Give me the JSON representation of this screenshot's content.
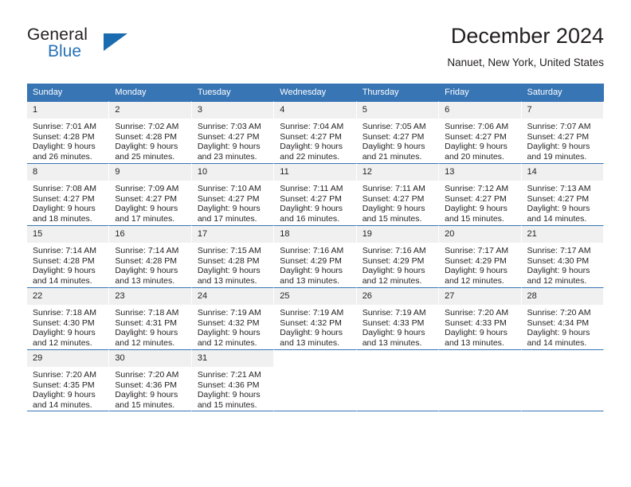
{
  "brand": {
    "name_top": "General",
    "name_bottom": "Blue",
    "accent_color": "#2572b8",
    "triangle_color": "#1a6bb0"
  },
  "header": {
    "title": "December 2024",
    "location": "Nanuet, New York, United States"
  },
  "calendar": {
    "header_bg": "#3875b5",
    "daynum_bg": "#f0f0f0",
    "weekdays": [
      "Sunday",
      "Monday",
      "Tuesday",
      "Wednesday",
      "Thursday",
      "Friday",
      "Saturday"
    ],
    "weeks": [
      [
        {
          "day": "1",
          "sunrise": "Sunrise: 7:01 AM",
          "sunset": "Sunset: 4:28 PM",
          "daylight1": "Daylight: 9 hours",
          "daylight2": "and 26 minutes."
        },
        {
          "day": "2",
          "sunrise": "Sunrise: 7:02 AM",
          "sunset": "Sunset: 4:28 PM",
          "daylight1": "Daylight: 9 hours",
          "daylight2": "and 25 minutes."
        },
        {
          "day": "3",
          "sunrise": "Sunrise: 7:03 AM",
          "sunset": "Sunset: 4:27 PM",
          "daylight1": "Daylight: 9 hours",
          "daylight2": "and 23 minutes."
        },
        {
          "day": "4",
          "sunrise": "Sunrise: 7:04 AM",
          "sunset": "Sunset: 4:27 PM",
          "daylight1": "Daylight: 9 hours",
          "daylight2": "and 22 minutes."
        },
        {
          "day": "5",
          "sunrise": "Sunrise: 7:05 AM",
          "sunset": "Sunset: 4:27 PM",
          "daylight1": "Daylight: 9 hours",
          "daylight2": "and 21 minutes."
        },
        {
          "day": "6",
          "sunrise": "Sunrise: 7:06 AM",
          "sunset": "Sunset: 4:27 PM",
          "daylight1": "Daylight: 9 hours",
          "daylight2": "and 20 minutes."
        },
        {
          "day": "7",
          "sunrise": "Sunrise: 7:07 AM",
          "sunset": "Sunset: 4:27 PM",
          "daylight1": "Daylight: 9 hours",
          "daylight2": "and 19 minutes."
        }
      ],
      [
        {
          "day": "8",
          "sunrise": "Sunrise: 7:08 AM",
          "sunset": "Sunset: 4:27 PM",
          "daylight1": "Daylight: 9 hours",
          "daylight2": "and 18 minutes."
        },
        {
          "day": "9",
          "sunrise": "Sunrise: 7:09 AM",
          "sunset": "Sunset: 4:27 PM",
          "daylight1": "Daylight: 9 hours",
          "daylight2": "and 17 minutes."
        },
        {
          "day": "10",
          "sunrise": "Sunrise: 7:10 AM",
          "sunset": "Sunset: 4:27 PM",
          "daylight1": "Daylight: 9 hours",
          "daylight2": "and 17 minutes."
        },
        {
          "day": "11",
          "sunrise": "Sunrise: 7:11 AM",
          "sunset": "Sunset: 4:27 PM",
          "daylight1": "Daylight: 9 hours",
          "daylight2": "and 16 minutes."
        },
        {
          "day": "12",
          "sunrise": "Sunrise: 7:11 AM",
          "sunset": "Sunset: 4:27 PM",
          "daylight1": "Daylight: 9 hours",
          "daylight2": "and 15 minutes."
        },
        {
          "day": "13",
          "sunrise": "Sunrise: 7:12 AM",
          "sunset": "Sunset: 4:27 PM",
          "daylight1": "Daylight: 9 hours",
          "daylight2": "and 15 minutes."
        },
        {
          "day": "14",
          "sunrise": "Sunrise: 7:13 AM",
          "sunset": "Sunset: 4:27 PM",
          "daylight1": "Daylight: 9 hours",
          "daylight2": "and 14 minutes."
        }
      ],
      [
        {
          "day": "15",
          "sunrise": "Sunrise: 7:14 AM",
          "sunset": "Sunset: 4:28 PM",
          "daylight1": "Daylight: 9 hours",
          "daylight2": "and 14 minutes."
        },
        {
          "day": "16",
          "sunrise": "Sunrise: 7:14 AM",
          "sunset": "Sunset: 4:28 PM",
          "daylight1": "Daylight: 9 hours",
          "daylight2": "and 13 minutes."
        },
        {
          "day": "17",
          "sunrise": "Sunrise: 7:15 AM",
          "sunset": "Sunset: 4:28 PM",
          "daylight1": "Daylight: 9 hours",
          "daylight2": "and 13 minutes."
        },
        {
          "day": "18",
          "sunrise": "Sunrise: 7:16 AM",
          "sunset": "Sunset: 4:29 PM",
          "daylight1": "Daylight: 9 hours",
          "daylight2": "and 13 minutes."
        },
        {
          "day": "19",
          "sunrise": "Sunrise: 7:16 AM",
          "sunset": "Sunset: 4:29 PM",
          "daylight1": "Daylight: 9 hours",
          "daylight2": "and 12 minutes."
        },
        {
          "day": "20",
          "sunrise": "Sunrise: 7:17 AM",
          "sunset": "Sunset: 4:29 PM",
          "daylight1": "Daylight: 9 hours",
          "daylight2": "and 12 minutes."
        },
        {
          "day": "21",
          "sunrise": "Sunrise: 7:17 AM",
          "sunset": "Sunset: 4:30 PM",
          "daylight1": "Daylight: 9 hours",
          "daylight2": "and 12 minutes."
        }
      ],
      [
        {
          "day": "22",
          "sunrise": "Sunrise: 7:18 AM",
          "sunset": "Sunset: 4:30 PM",
          "daylight1": "Daylight: 9 hours",
          "daylight2": "and 12 minutes."
        },
        {
          "day": "23",
          "sunrise": "Sunrise: 7:18 AM",
          "sunset": "Sunset: 4:31 PM",
          "daylight1": "Daylight: 9 hours",
          "daylight2": "and 12 minutes."
        },
        {
          "day": "24",
          "sunrise": "Sunrise: 7:19 AM",
          "sunset": "Sunset: 4:32 PM",
          "daylight1": "Daylight: 9 hours",
          "daylight2": "and 12 minutes."
        },
        {
          "day": "25",
          "sunrise": "Sunrise: 7:19 AM",
          "sunset": "Sunset: 4:32 PM",
          "daylight1": "Daylight: 9 hours",
          "daylight2": "and 13 minutes."
        },
        {
          "day": "26",
          "sunrise": "Sunrise: 7:19 AM",
          "sunset": "Sunset: 4:33 PM",
          "daylight1": "Daylight: 9 hours",
          "daylight2": "and 13 minutes."
        },
        {
          "day": "27",
          "sunrise": "Sunrise: 7:20 AM",
          "sunset": "Sunset: 4:33 PM",
          "daylight1": "Daylight: 9 hours",
          "daylight2": "and 13 minutes."
        },
        {
          "day": "28",
          "sunrise": "Sunrise: 7:20 AM",
          "sunset": "Sunset: 4:34 PM",
          "daylight1": "Daylight: 9 hours",
          "daylight2": "and 14 minutes."
        }
      ],
      [
        {
          "day": "29",
          "sunrise": "Sunrise: 7:20 AM",
          "sunset": "Sunset: 4:35 PM",
          "daylight1": "Daylight: 9 hours",
          "daylight2": "and 14 minutes."
        },
        {
          "day": "30",
          "sunrise": "Sunrise: 7:20 AM",
          "sunset": "Sunset: 4:36 PM",
          "daylight1": "Daylight: 9 hours",
          "daylight2": "and 15 minutes."
        },
        {
          "day": "31",
          "sunrise": "Sunrise: 7:21 AM",
          "sunset": "Sunset: 4:36 PM",
          "daylight1": "Daylight: 9 hours",
          "daylight2": "and 15 minutes."
        },
        null,
        null,
        null,
        null
      ]
    ]
  }
}
